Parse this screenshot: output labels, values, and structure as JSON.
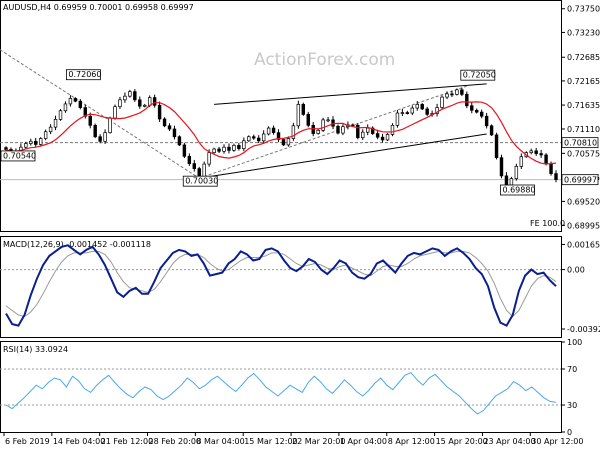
{
  "colors": {
    "candle": "#000000",
    "ma": "#e8141c",
    "macd": "#0a1f8f",
    "signal": "#9a9a9a",
    "rsi": "#4aa8e8",
    "dotted": "#777777",
    "grid": "#000000"
  },
  "header": {
    "symbol_line": "AUDUSD,H4  0.69959 0.70001 0.69958 0.69997"
  },
  "watermark": "ActionForex.com",
  "chart_data": [
    {
      "type": "candlestick",
      "panel": "price",
      "title": "AUDUSD,H4  0.69959 0.70001 0.69958 0.69997",
      "y_ticks": [
        "0.73750",
        "0.73230",
        "0.72685",
        "0.72165",
        "0.71635",
        "0.71110",
        "0.70575",
        "0.70045",
        "0.69520",
        "0.68995"
      ],
      "y_tick_values": [
        0.7375,
        0.7323,
        0.72685,
        0.72165,
        0.71635,
        0.7111,
        0.70575,
        0.70045,
        0.6952,
        0.68995
      ],
      "ylim": [
        0.6887,
        0.7392
      ],
      "close_series": [
        0.7066,
        0.7058,
        0.7062,
        0.7071,
        0.7079,
        0.7084,
        0.7077,
        0.709,
        0.7105,
        0.7115,
        0.7132,
        0.7151,
        0.7166,
        0.7178,
        0.7172,
        0.7158,
        0.7139,
        0.7119,
        0.7094,
        0.7084,
        0.7103,
        0.7135,
        0.716,
        0.7175,
        0.7183,
        0.7193,
        0.7175,
        0.7161,
        0.7163,
        0.718,
        0.7163,
        0.7133,
        0.7118,
        0.7111,
        0.7094,
        0.7076,
        0.7051,
        0.7035,
        0.7024,
        0.7004,
        0.7034,
        0.7059,
        0.7067,
        0.7062,
        0.7071,
        0.7064,
        0.7075,
        0.7068,
        0.7085,
        0.7094,
        0.7091,
        0.7085,
        0.71,
        0.7113,
        0.7103,
        0.7088,
        0.7076,
        0.709,
        0.7118,
        0.7165,
        0.7143,
        0.7119,
        0.7101,
        0.7108,
        0.7131,
        0.7131,
        0.7117,
        0.7102,
        0.7116,
        0.712,
        0.7119,
        0.7092,
        0.7104,
        0.7113,
        0.7101,
        0.7093,
        0.7087,
        0.7099,
        0.7119,
        0.7146,
        0.7147,
        0.7146,
        0.7157,
        0.7165,
        0.7155,
        0.7143,
        0.7145,
        0.7158,
        0.7181,
        0.7188,
        0.7187,
        0.7197,
        0.7187,
        0.7162,
        0.7152,
        0.7148,
        0.7139,
        0.7118,
        0.7098,
        0.7048,
        0.7008,
        0.6988,
        0.7002,
        0.7029,
        0.705,
        0.7059,
        0.7063,
        0.7057,
        0.7054,
        0.7034,
        0.7013,
        0.7
      ],
      "moving_average_label": "",
      "price_labels": [
        {
          "text": "0.72060",
          "value": 0.7206
        },
        {
          "text": "0.72050",
          "value": 0.7205
        },
        {
          "text": "0.70030",
          "value": 0.7003
        },
        {
          "text": "0.69880",
          "value": 0.6988
        },
        {
          "text": "0.70540",
          "value": 0.7054
        }
      ],
      "axis_flags": [
        {
          "text": "0.70810",
          "value": 0.7081
        },
        {
          "text": "0.69997",
          "value": 0.69997
        }
      ],
      "fib_label": "FE 100.0",
      "annotations": [
        "Upper channel line",
        "Lower channel line",
        "Dotted resistance line",
        "Dotted support line",
        "Horizontal dotted line at 0.70810"
      ]
    },
    {
      "type": "line",
      "panel": "macd",
      "title": "MACD(12,26,9) -0.001452 -0.001118",
      "y_ticks": [
        "0.001659",
        "0.00",
        "-0.003922"
      ],
      "y_tick_values": [
        0.001659,
        0.0,
        -0.003922
      ],
      "ylim": [
        -0.00445,
        0.00215
      ],
      "series": [
        {
          "values": [
            -0.0029,
            -0.0036,
            -0.0037,
            -0.003,
            -0.0017,
            -0.0006,
            0.0003,
            0.0009,
            0.0012,
            0.0015,
            0.0016,
            0.0013,
            0.001,
            0.0013,
            0.0015,
            0.001,
            0.0003,
            -0.0006,
            -0.0015,
            -0.0018,
            -0.0014,
            -0.0012,
            -0.0016,
            -0.0016,
            -0.0008,
            0.0001,
            0.0006,
            0.0011,
            0.0013,
            0.0012,
            0.0009,
            0.001,
            0.0004,
            -0.0004,
            -0.0003,
            -0.0002,
            0.0004,
            0.0007,
            0.0012,
            0.001,
            0.0006,
            0.0007,
            0.0013,
            0.0014,
            0.0012,
            0.0006,
            0.0001,
            -0.0001,
            0.0002,
            0.0007,
            0.0005,
            0.0,
            -0.0003,
            0.0001,
            0.0006,
            0.0004,
            -0.0002,
            -0.0005,
            -0.0006,
            -0.0003,
            0.0004,
            0.0006,
            0.0002,
            -0.0002,
            0.0004,
            0.0009,
            0.0011,
            0.001,
            0.0012,
            0.0014,
            0.0013,
            0.0009,
            0.0012,
            0.0014,
            0.0011,
            0.0007,
            0.0001,
            -0.0003,
            -0.0011,
            -0.0025,
            -0.0035,
            -0.0037,
            -0.003,
            -0.0014,
            -0.0004,
            0.0,
            -0.0003,
            -0.0002,
            -0.0007,
            -0.0011
          ]
        },
        {
          "values": [
            -0.0024,
            -0.0027,
            -0.003,
            -0.0031,
            -0.0028,
            -0.0023,
            -0.0016,
            -0.0008,
            -0.0001,
            0.0005,
            0.0009,
            0.0011,
            0.0011,
            0.0011,
            0.0012,
            0.0012,
            0.001,
            0.0005,
            -0.0002,
            -0.0008,
            -0.0012,
            -0.0013,
            -0.0014,
            -0.0015,
            -0.0013,
            -0.0008,
            -0.0002,
            0.0004,
            0.0008,
            0.001,
            0.001,
            0.001,
            0.0008,
            0.0004,
            0.0001,
            -0.0001,
            0.0,
            0.0003,
            0.0006,
            0.0008,
            0.0008,
            0.0008,
            0.0009,
            0.0011,
            0.0011,
            0.001,
            0.0007,
            0.0004,
            0.0002,
            0.0003,
            0.0004,
            0.0003,
            0.0001,
            0.0,
            0.0002,
            0.0003,
            0.0001,
            -0.0001,
            -0.0003,
            -0.0004,
            -0.0001,
            0.0002,
            0.0003,
            0.0002,
            0.0002,
            0.0004,
            0.0007,
            0.0009,
            0.001,
            0.0011,
            0.0012,
            0.0011,
            0.0011,
            0.0012,
            0.0012,
            0.0011,
            0.0008,
            0.0004,
            -0.0001,
            -0.0009,
            -0.0019,
            -0.0027,
            -0.0031,
            -0.0027,
            -0.0019,
            -0.0011,
            -0.0006,
            -0.0004,
            -0.0005,
            -0.0008
          ]
        }
      ]
    },
    {
      "type": "line",
      "panel": "rsi",
      "title": "RSI(14) 33.0924",
      "y_ticks": [
        "100",
        "70",
        "30",
        "0"
      ],
      "y_tick_values": [
        100,
        70,
        30,
        0
      ],
      "ylim": [
        0,
        100
      ],
      "reference_lines": [
        70,
        30
      ],
      "series": [
        {
          "values": [
            30,
            26,
            32,
            38,
            45,
            52,
            48,
            55,
            60,
            58,
            50,
            62,
            57,
            48,
            44,
            52,
            58,
            63,
            55,
            48,
            42,
            38,
            45,
            50,
            47,
            40,
            36,
            40,
            46,
            52,
            60,
            55,
            48,
            52,
            58,
            62,
            56,
            50,
            45,
            52,
            60,
            65,
            58,
            50,
            45,
            40,
            46,
            52,
            48,
            44,
            55,
            62,
            56,
            48,
            43,
            50,
            58,
            52,
            45,
            40,
            46,
            54,
            60,
            52,
            47,
            55,
            63,
            66,
            58,
            52,
            60,
            64,
            57,
            50,
            45,
            40,
            33,
            26,
            20,
            24,
            32,
            40,
            44,
            48,
            56,
            52,
            46,
            50,
            44,
            38,
            34,
            33
          ]
        }
      ]
    }
  ],
  "time_axis": {
    "labels": [
      "6 Feb 2019",
      "14 Feb 04:00",
      "21 Feb 12:00",
      "28 Feb 20:00",
      "8 Mar 04:00",
      "15 Mar 12:00",
      "22 Mar 20:00",
      "1 Apr 04:00",
      "8 Apr 12:00",
      "15 Apr 20:00",
      "23 Apr 04:00",
      "30 Apr 12:00"
    ]
  }
}
